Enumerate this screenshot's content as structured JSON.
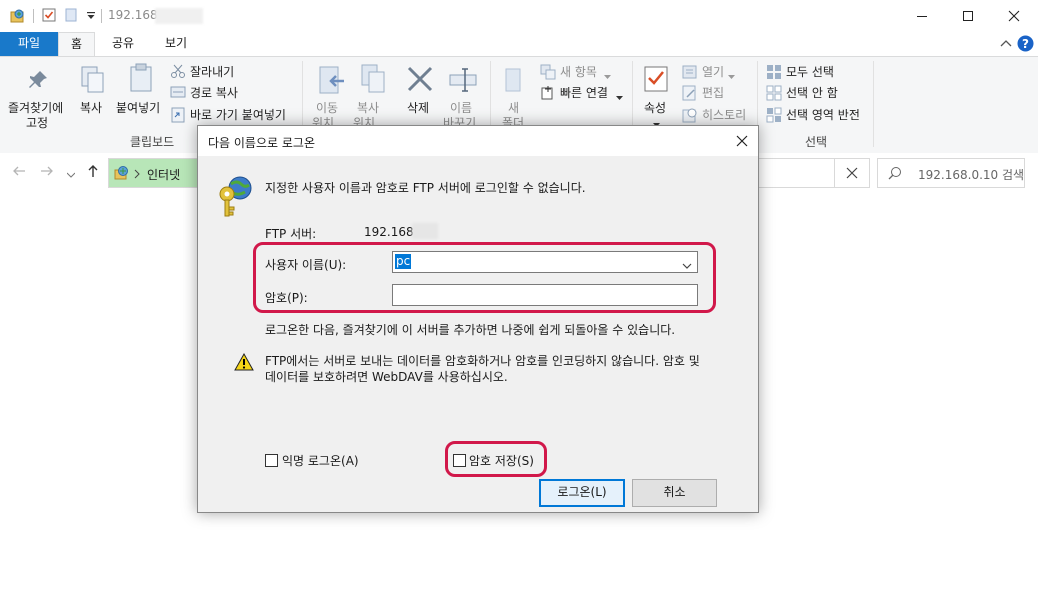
{
  "window": {
    "title": "192.168"
  },
  "window_controls": {
    "minimize": "—",
    "maximize": "☐",
    "close": "✕"
  },
  "tabs": [
    {
      "label": "파일"
    },
    {
      "label": "홈"
    },
    {
      "label": "공유"
    },
    {
      "label": "보기"
    }
  ],
  "ribbon": {
    "clipboard": {
      "pin_label_1": "즐겨찾기에",
      "pin_label_2": "고정",
      "copy": "복사",
      "paste": "붙여넣기",
      "cut": "잘라내기",
      "copy_path": "경로 복사",
      "paste_shortcut": "바로 가기 붙여넣기",
      "group": "클립보드"
    },
    "organize": {
      "move_1": "이동",
      "move_2": "위치",
      "copy_1": "복사",
      "copy_2": "위치",
      "delete": "삭제",
      "rename_1": "이름",
      "rename_2": "바꾸기"
    },
    "new": {
      "folder_1": "새",
      "folder_2": "폴더",
      "new_item": "새 항목",
      "easy_access": "빠른 연결"
    },
    "open": {
      "properties": "속성",
      "open": "열기",
      "edit": "편집",
      "history": "히스토리"
    },
    "select": {
      "select_all": "모두 선택",
      "select_none": "선택 안 함",
      "invert": "선택 영역 반전",
      "group": "선택"
    }
  },
  "address": {
    "crumb": "인터넷",
    "clear": "✕"
  },
  "search": {
    "placeholder": "192.168.0.10 검색"
  },
  "dialog": {
    "title": "다음 이름으로 로그온",
    "message": "지정한 사용자 이름과 암호로 FTP 서버에 로그인할 수 없습니다.",
    "server_label": "FTP 서버:",
    "server_value": "192.168.0",
    "username_label": "사용자 이름(U):",
    "username_value": "pc",
    "password_label": "암호(P):",
    "password_value": "",
    "info": "로그온한 다음, 즐겨찾기에 이 서버를 추가하면 나중에 쉽게 되돌아올 수 있습니다.",
    "warning_1": "FTP에서는 서버로 보내는 데이터를 암호화하거나 암호를 인코딩하지 않습니다. 암호 및",
    "warning_2": "데이터를 보호하려면 WebDAV를 사용하십시오.",
    "anonymous_label": "익명 로그온(A)",
    "anonymous_checked": false,
    "save_password_label": "암호 저장(S)",
    "save_password_checked": false,
    "login_button": "로그온(L)",
    "cancel_button": "취소"
  },
  "colors": {
    "accent": "#1979ca",
    "highlight": "#d1184a",
    "dialog_bg": "#f0f0f0"
  }
}
